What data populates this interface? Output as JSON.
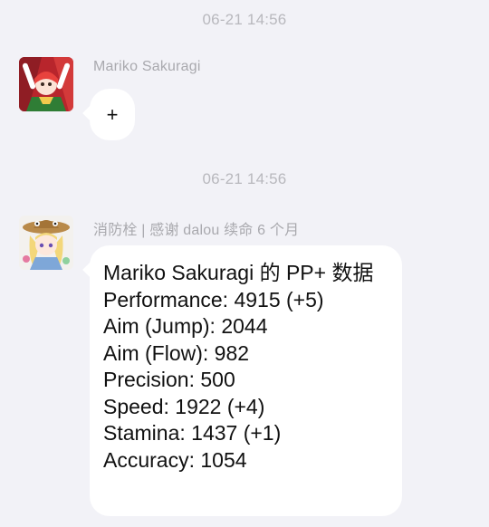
{
  "messages": [
    {
      "timestamp": "06-21 14:56",
      "sender": "Mariko Sakuragi",
      "text": "+"
    },
    {
      "timestamp": "06-21 14:56",
      "sender": "消防栓 | 感谢 dalou 续命 6 个月",
      "title": "Mariko Sakuragi 的 PP+ 数据",
      "lines": [
        "Performance: 4915 (+5)",
        "Aim (Jump): 2044",
        "Aim (Flow): 982",
        "Precision: 500",
        "Speed: 1922 (+4)",
        "Stamina: 1437 (+1)",
        "Accuracy: 1054"
      ]
    }
  ]
}
